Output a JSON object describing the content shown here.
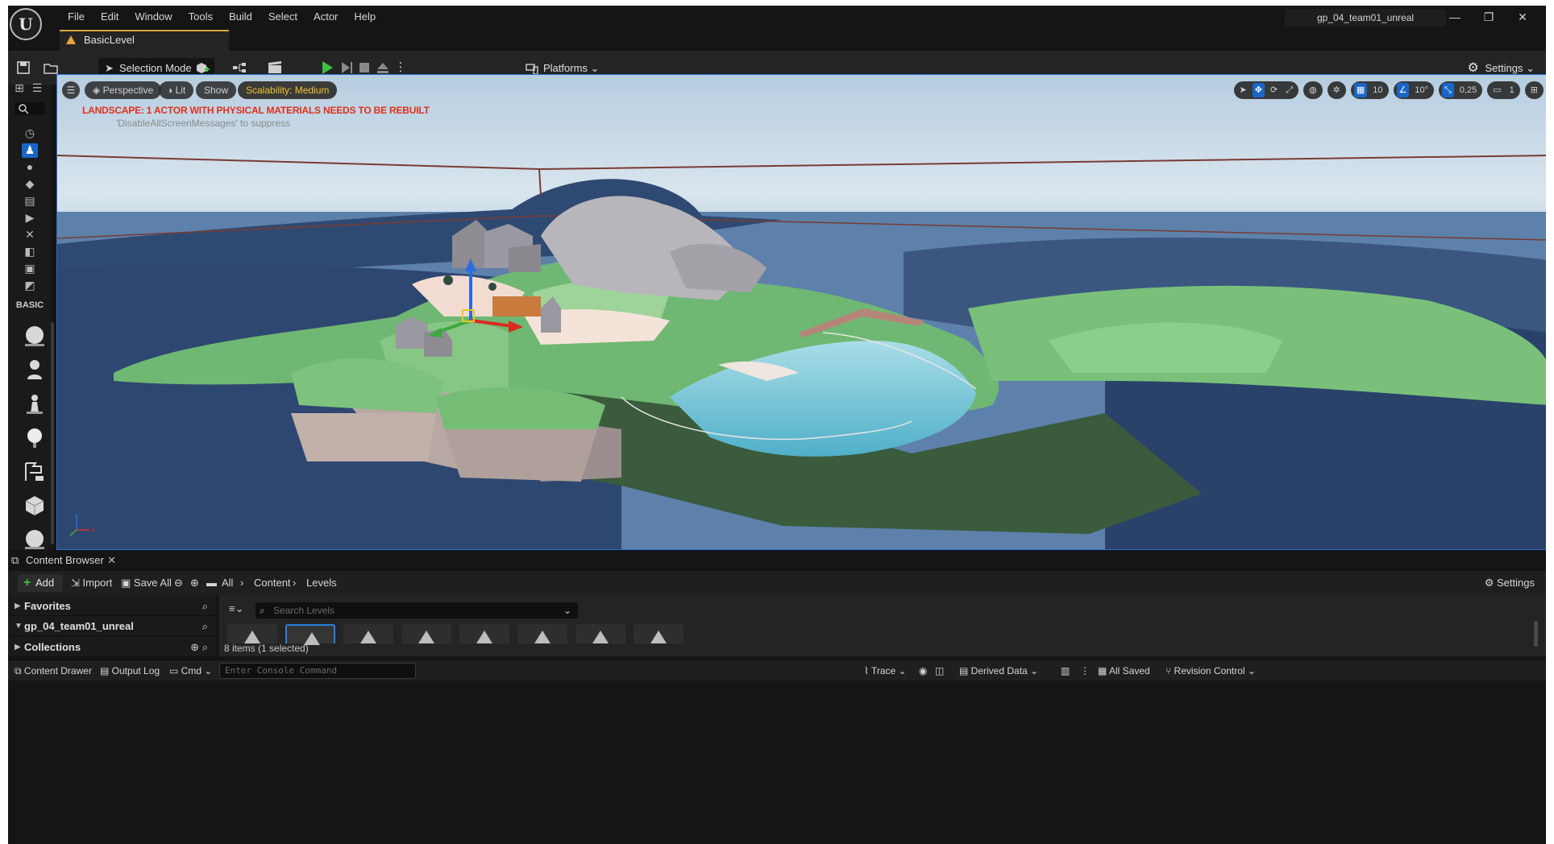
{
  "window": {
    "project_name": "gp_04_team01_unreal",
    "menu": [
      "File",
      "Edit",
      "Window",
      "Tools",
      "Build",
      "Select",
      "Actor",
      "Help"
    ],
    "level_tab": "BasicLevel",
    "minimize": "—",
    "restore": "❐",
    "close": "✕"
  },
  "toolbar": {
    "selection_mode": "Selection Mode",
    "platforms": "Platforms",
    "settings": "Settings"
  },
  "left_panel": {
    "section_label": "BASIC"
  },
  "viewport": {
    "perspective": "Perspective",
    "lit": "Lit",
    "show": "Show",
    "scalability": "Scalability: Medium",
    "grid_snap": "10",
    "rotation_snap": "10°",
    "scale_snap": "0,25",
    "camera_speed": "1",
    "warning": "LANDSCAPE: 1 ACTOR WITH PHYSICAL MATERIALS NEEDS TO BE REBUILT",
    "warning_hint": "'DisableAllScreenMessages' to suppress",
    "axis_x": "x"
  },
  "content_browser": {
    "tab_title": "Content Browser",
    "add": "Add",
    "import": "Import",
    "save_all": "Save All",
    "breadcrumb": [
      "All",
      "Content",
      "Levels"
    ],
    "settings": "Settings",
    "sections": [
      "Favorites",
      "gp_04_team01_unreal",
      "Collections"
    ],
    "search_placeholder": "Search Levels",
    "items_status": "8 items (1 selected)"
  },
  "statusbar": {
    "content_drawer": "Content Drawer",
    "output_log": "Output Log",
    "cmd": "Cmd",
    "console_placeholder": "Enter Console Command",
    "trace": "Trace",
    "derived_data": "Derived Data",
    "all_saved": "All Saved",
    "revision_control": "Revision Control"
  }
}
